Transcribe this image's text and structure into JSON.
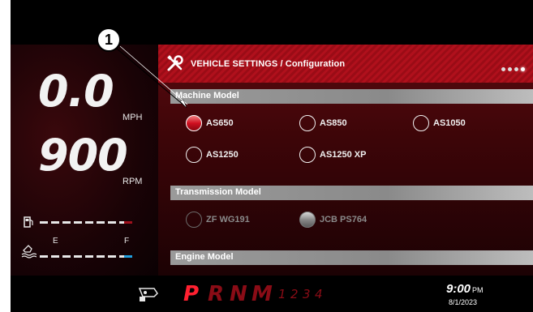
{
  "callout": {
    "number": "1"
  },
  "speed": {
    "value": "0.0",
    "unit": "MPH"
  },
  "rpm": {
    "value": "900",
    "unit": "RPM"
  },
  "gauges": {
    "fuel_icon": "fuel-pump-icon",
    "def_icon": "def-fluid-icon",
    "empty_label": "E",
    "full_label": "F"
  },
  "header": {
    "title": "VEHICLE SETTINGS / Configuration",
    "icon": "wrench-screwdriver-icon",
    "page_count": 4,
    "active_page": 4
  },
  "machine_model": {
    "title": "Machine Model",
    "options": [
      "AS650",
      "AS850",
      "AS1050",
      "AS1250",
      "AS1250 XP"
    ],
    "selected": "AS650"
  },
  "transmission_model": {
    "title": "Transmission Model",
    "options": [
      "ZF WG191",
      "JCB PS764"
    ],
    "selected": "JCB PS764",
    "disabled": true
  },
  "engine_model": {
    "title": "Engine Model"
  },
  "gear_selector": {
    "gears": [
      "P",
      "R",
      "N",
      "M"
    ],
    "manual_gears": [
      "1",
      "2",
      "3",
      "4"
    ],
    "active": "P",
    "icon": "transmission-lock-icon"
  },
  "clock": {
    "time": "9:00",
    "ampm": "PM",
    "date": "8/1/2023"
  },
  "colors": {
    "accent_red": "#b0101c",
    "selected_red": "#d01020",
    "fuel_marker": "#a0101c",
    "def_marker": "#20a0e0"
  }
}
